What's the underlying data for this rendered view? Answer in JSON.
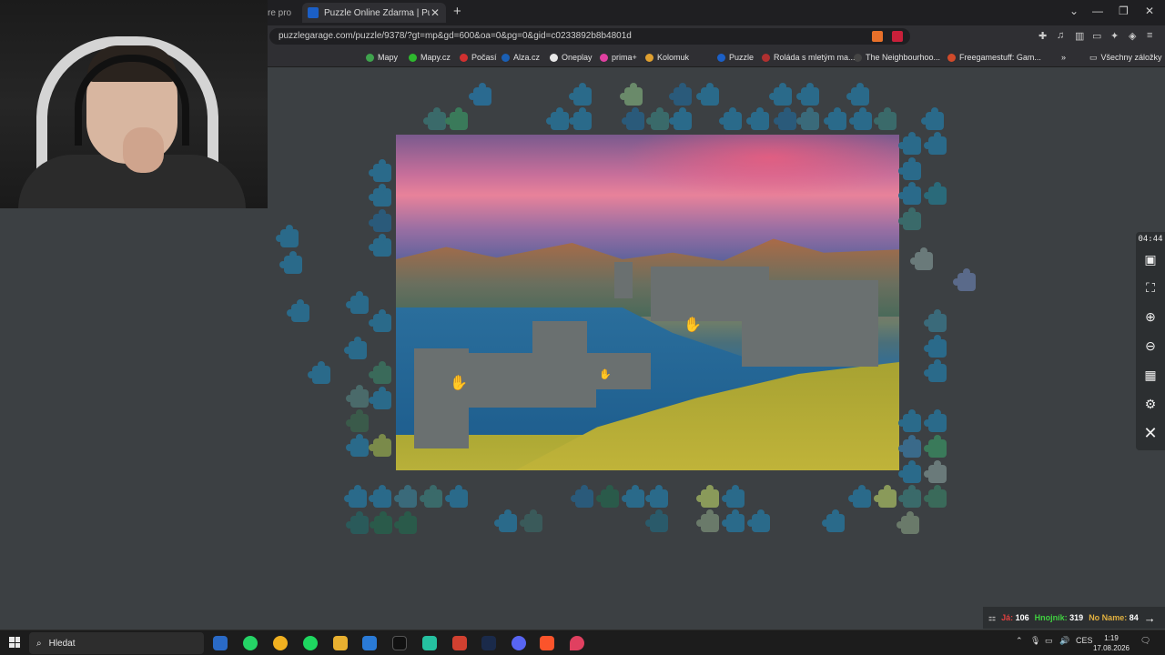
{
  "browser": {
    "prev_tab_title": "re pro",
    "active_tab_title": "Puzzle Online Zdarma | Puzzle G",
    "url": "puzzlegarage.com/puzzle/9378/?gt=mp&gd=600&oa=0&pg=0&gid=c0233892b8b4801d",
    "bookmarks": [
      "Mapy",
      "Mapy.cz",
      "Počasí",
      "Alza.cz",
      "Oneplay",
      "prima+",
      "Kolomuk",
      "Puzzle",
      "Roláda s mletým ma...",
      "The Neighbourhoo...",
      "Freegamestuff: Gam..."
    ],
    "all_bookmarks": "Všechny záložky"
  },
  "puzzle": {
    "timer": "04:44",
    "players": [
      {
        "name": "Já:",
        "score": "106",
        "color": "#e04040"
      },
      {
        "name": "Hnojník:",
        "score": "319",
        "color": "#40d040"
      },
      {
        "name": "No Name:",
        "score": "84",
        "color": "#e0b040"
      }
    ],
    "tools": [
      "image-icon",
      "fullscreen-icon",
      "zoom-in-icon",
      "zoom-out-icon",
      "grid-icon",
      "settings-icon",
      "close-icon"
    ]
  },
  "taskbar": {
    "search_placeholder": "Hledat",
    "language": "CES",
    "time": "1:19",
    "date": "17.08.2026"
  }
}
